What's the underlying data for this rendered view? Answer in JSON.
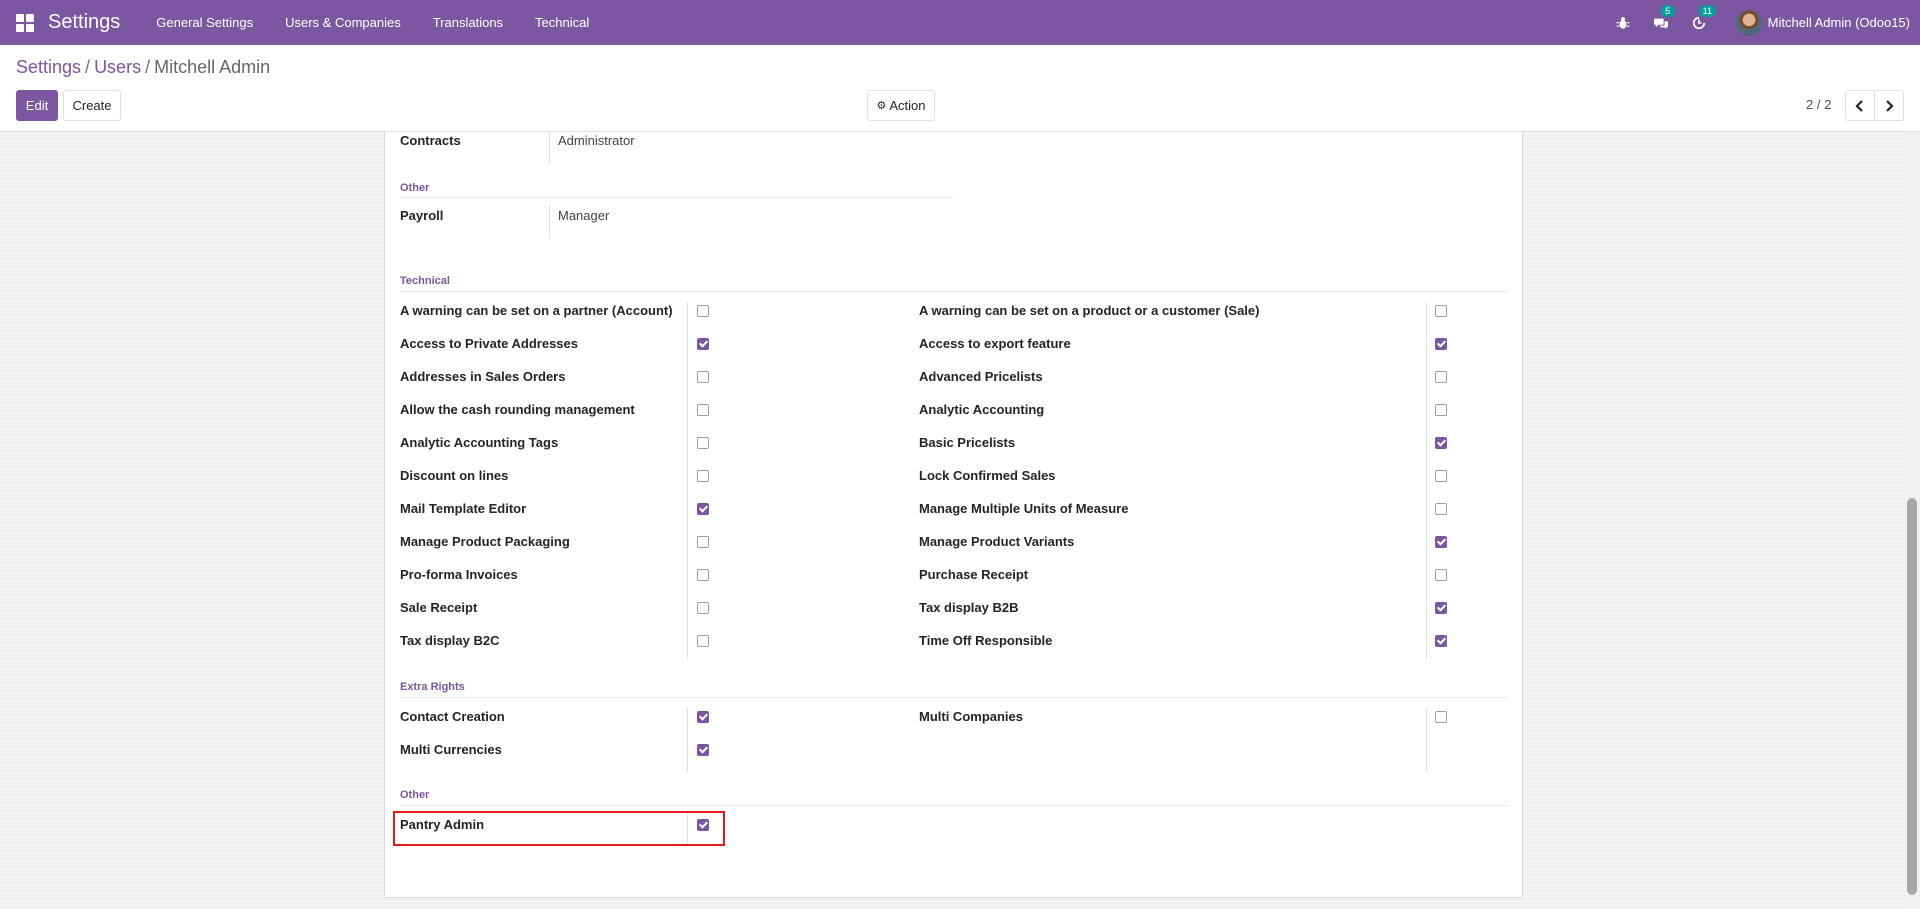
{
  "navbar": {
    "brand": "Settings",
    "menu": [
      "General Settings",
      "Users & Companies",
      "Translations",
      "Technical"
    ],
    "chat_badge": "5",
    "activity_badge": "11",
    "user_name": "Mitchell Admin (Odoo15)"
  },
  "breadcrumb": {
    "settings": "Settings",
    "users": "Users",
    "current": "Mitchell Admin"
  },
  "buttons": {
    "edit": "Edit",
    "create": "Create",
    "action": "Action"
  },
  "pager": {
    "value": "2 / 2"
  },
  "form": {
    "contracts": {
      "label": "Contracts",
      "value": "Administrator"
    },
    "other_top": {
      "title": "Other"
    },
    "payroll": {
      "label": "Payroll",
      "value": "Manager"
    },
    "technical": {
      "title": "Technical",
      "left": [
        {
          "label": "A warning can be set on a partner (Account)",
          "checked": false
        },
        {
          "label": "Access to Private Addresses",
          "checked": true
        },
        {
          "label": "Addresses in Sales Orders",
          "checked": false
        },
        {
          "label": "Allow the cash rounding management",
          "checked": false
        },
        {
          "label": "Analytic Accounting Tags",
          "checked": false
        },
        {
          "label": "Discount on lines",
          "checked": false
        },
        {
          "label": "Mail Template Editor",
          "checked": true
        },
        {
          "label": "Manage Product Packaging",
          "checked": false
        },
        {
          "label": "Pro-forma Invoices",
          "checked": false
        },
        {
          "label": "Sale Receipt",
          "checked": false
        },
        {
          "label": "Tax display B2C",
          "checked": false
        }
      ],
      "right": [
        {
          "label": "A warning can be set on a product or a customer (Sale)",
          "checked": false
        },
        {
          "label": "Access to export feature",
          "checked": true
        },
        {
          "label": "Advanced Pricelists",
          "checked": false
        },
        {
          "label": "Analytic Accounting",
          "checked": false
        },
        {
          "label": "Basic Pricelists",
          "checked": true
        },
        {
          "label": "Lock Confirmed Sales",
          "checked": false
        },
        {
          "label": "Manage Multiple Units of Measure",
          "checked": false
        },
        {
          "label": "Manage Product Variants",
          "checked": true
        },
        {
          "label": "Purchase Receipt",
          "checked": false
        },
        {
          "label": "Tax display B2B",
          "checked": true
        },
        {
          "label": "Time Off Responsible",
          "checked": true
        }
      ]
    },
    "extra_rights": {
      "title": "Extra Rights",
      "left": [
        {
          "label": "Contact Creation",
          "checked": true
        },
        {
          "label": "Multi Currencies",
          "checked": true
        }
      ],
      "right": [
        {
          "label": "Multi Companies",
          "checked": false
        }
      ]
    },
    "other_bottom": {
      "title": "Other",
      "items": [
        {
          "label": "Pantry Admin",
          "checked": true
        }
      ]
    }
  },
  "colors": {
    "brand": "#7c56a0",
    "badge": "#00a09d",
    "highlight": "#e21b1b"
  }
}
